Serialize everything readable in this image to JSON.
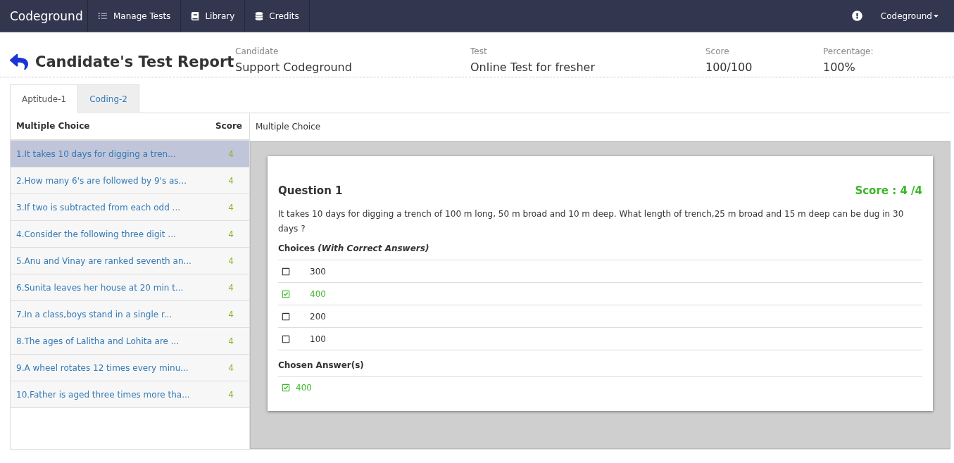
{
  "navbar": {
    "brand": "Codeground",
    "items": [
      {
        "kind": "list",
        "label": "Manage Tests"
      },
      {
        "kind": "book",
        "label": "Library"
      },
      {
        "kind": "database",
        "label": "Credits"
      }
    ],
    "user": "Codeground"
  },
  "header": {
    "title": "Candidate's Test Report",
    "fields": [
      {
        "label": "Candidate",
        "value": "Support Codeground"
      },
      {
        "label": "Test",
        "value": "Online Test for fresher"
      },
      {
        "label": "Score",
        "value": "100/100"
      },
      {
        "label": "Percentage:",
        "value": "100%"
      }
    ]
  },
  "tabs": [
    {
      "label": "Aptitude-1",
      "selected": true
    },
    {
      "label": "Coding-2",
      "selected": false
    }
  ],
  "question_list": {
    "heading": "Multiple Choice",
    "score_heading": "Score",
    "rows": [
      {
        "text": "1.It takes 10 days for digging a tren...",
        "score": "4",
        "selected": true
      },
      {
        "text": "2.How many 6's are followed by 9's as...",
        "score": "4",
        "selected": false
      },
      {
        "text": "3.If two is subtracted from each odd ...",
        "score": "4",
        "selected": false
      },
      {
        "text": "4.Consider the following three digit ...",
        "score": "4",
        "selected": false
      },
      {
        "text": "5.Anu and Vinay are ranked seventh an...",
        "score": "4",
        "selected": false
      },
      {
        "text": "6.Sunita leaves her house at 20 min t...",
        "score": "4",
        "selected": false
      },
      {
        "text": "7.In a class,boys stand in a single r...",
        "score": "4",
        "selected": false
      },
      {
        "text": "8.The ages of Lalitha and Lohita are ...",
        "score": "4",
        "selected": false
      },
      {
        "text": "9.A wheel rotates 12 times every minu...",
        "score": "4",
        "selected": false
      },
      {
        "text": "10.Father is aged three times more tha...",
        "score": "4",
        "selected": false
      }
    ]
  },
  "detail": {
    "heading": "Multiple Choice",
    "question_title": "Question 1",
    "score": "Score : 4 /4",
    "question_text": "It takes 10 days for digging a trench of 100 m long, 50 m broad and 10 m deep. What length of trench,25 m broad and 15 m deep can be dug in 30 days ?",
    "choices_heading": "Choices *(With Correct Answers)*",
    "choices": [
      {
        "label": "300",
        "checked": false
      },
      {
        "label": "400",
        "checked": true
      },
      {
        "label": "200",
        "checked": false
      },
      {
        "label": "100",
        "checked": false
      }
    ],
    "chosen_heading": "Chosen Answer(s)",
    "chosen": [
      {
        "label": "400",
        "checked": true
      }
    ]
  }
}
